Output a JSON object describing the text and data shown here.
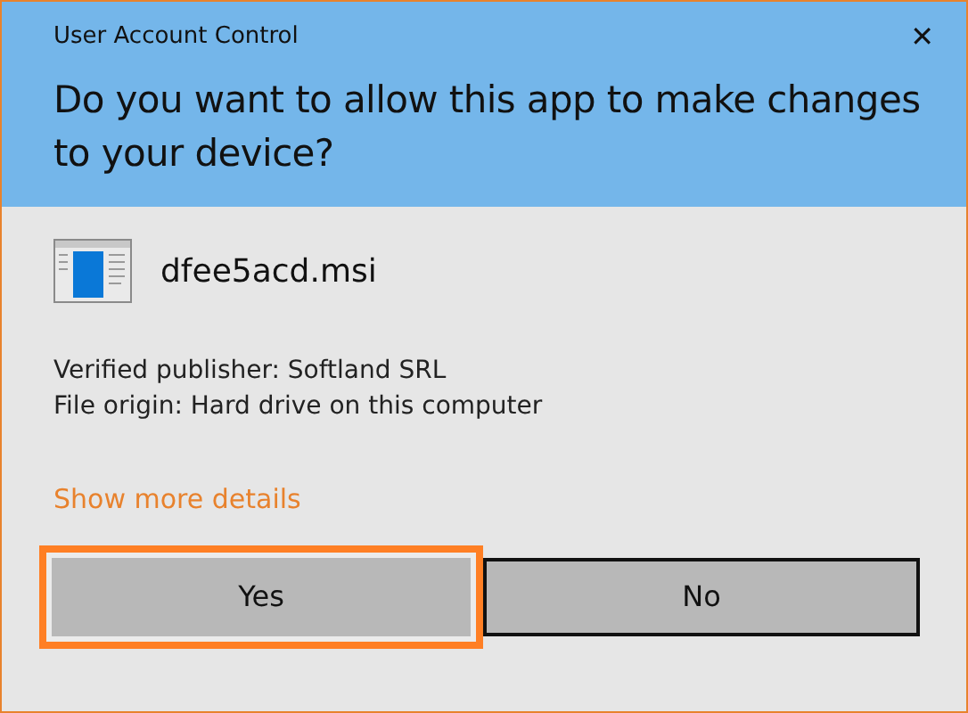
{
  "window": {
    "title": "User Account Control",
    "close": "✕"
  },
  "question": "Do you want to allow this app to make changes to your device?",
  "program": {
    "file_name": "dfee5acd.msi"
  },
  "details": [
    "Verified publisher: Softland SRL",
    "File origin: Hard drive on this computer"
  ],
  "more_details_link": "Show more details",
  "buttons": [
    {
      "label": "Yes",
      "highlighted": true
    },
    {
      "label": "No",
      "highlighted": false
    }
  ]
}
